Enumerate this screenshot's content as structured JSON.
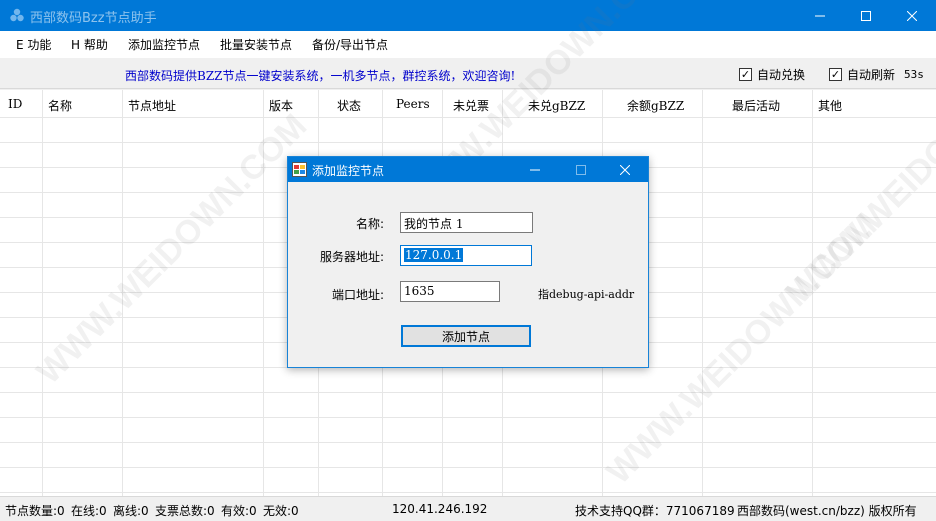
{
  "window": {
    "title": "西部数码Bzz节点助手",
    "controls": [
      "minimize",
      "maximize",
      "close"
    ]
  },
  "menu": {
    "items": [
      {
        "label": "E 功能"
      },
      {
        "label": "H 帮助"
      },
      {
        "label": "添加监控节点"
      },
      {
        "label": "批量安装节点"
      },
      {
        "label": "备份/导出节点"
      }
    ]
  },
  "infobar": {
    "promo": "西部数码提供BZZ节点一键安装系统，一机多节点，群控系统，欢迎咨询!",
    "auto_exchange": {
      "label": "自动兑换",
      "checked": true
    },
    "auto_refresh": {
      "label": "自动刷新",
      "checked": true,
      "countdown": "53s"
    }
  },
  "table": {
    "columns": [
      "ID",
      "名称",
      "节点地址",
      "版本",
      "状态",
      "Peers",
      "未兑票",
      "未兑gBZZ",
      "余额gBZZ",
      "最后活动",
      "其他"
    ],
    "rows": []
  },
  "status": {
    "node_count": "节点数量:0",
    "online": "在线:0",
    "offline": "离线:0",
    "tickets": "支票总数:0",
    "valid": "有效:0",
    "invalid": "无效:0",
    "ip": "120.41.246.192",
    "support": "技术支持QQ群：771067189",
    "brand": "西部数码(west.cn/bzz) 版权所有"
  },
  "watermark_text": "WWW.WEIDOWN.COM",
  "dialog": {
    "title": "添加监控节点",
    "name_label": "名称:",
    "name_value": "我的节点 1",
    "server_label": "服务器地址:",
    "server_value": "127.0.0.1",
    "port_label": "端口地址:",
    "port_value": "1635",
    "port_hint": "指debug-api-addr",
    "submit_label": "添加节点"
  },
  "colors": {
    "titlebar": "#0078d7",
    "promo_text": "#0000cc",
    "grid_line": "#e6e6e6"
  }
}
